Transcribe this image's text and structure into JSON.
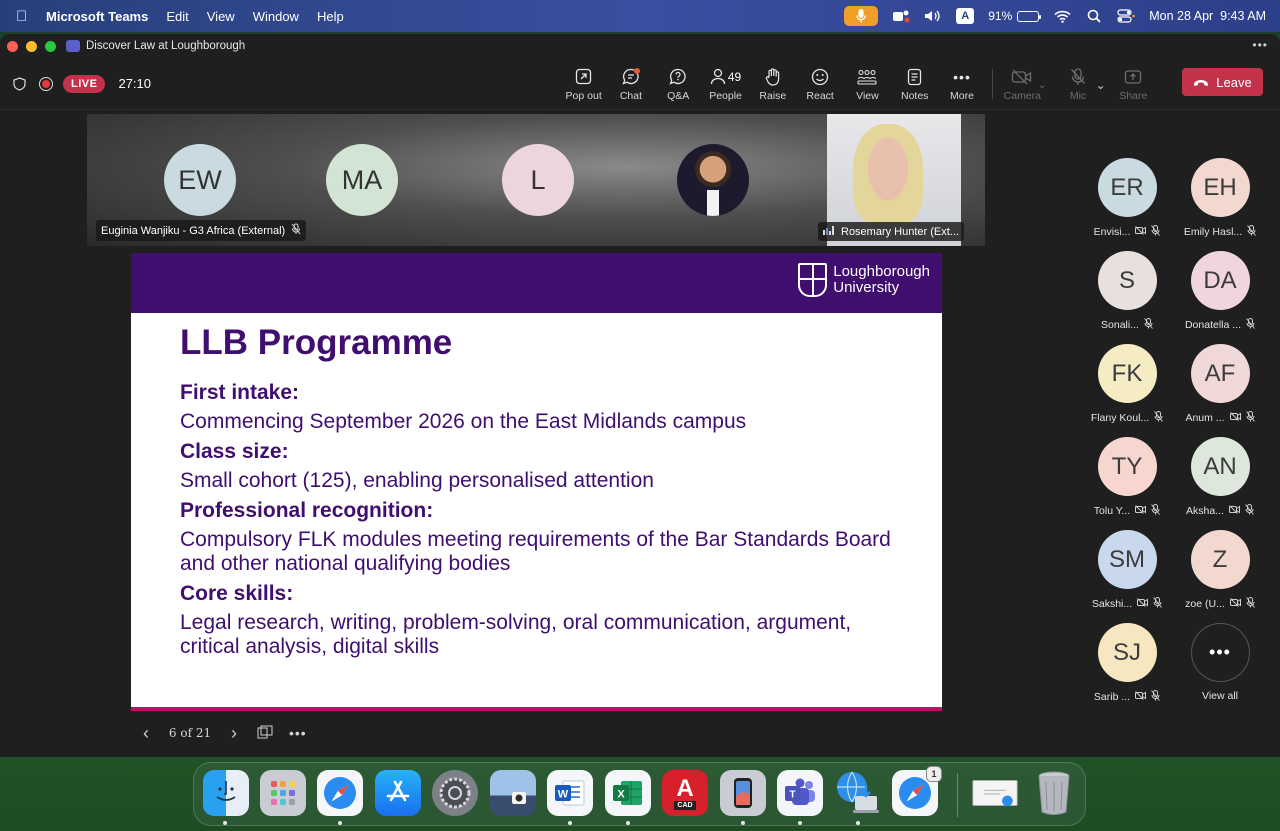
{
  "menubar": {
    "app_name": "Microsoft Teams",
    "menus": [
      "Edit",
      "View",
      "Window",
      "Help"
    ],
    "battery_percent": "91%",
    "battery_level": 0.91,
    "datetime": "Mon 28 Apr  9:43 AM",
    "input_key": "A"
  },
  "window": {
    "title": "Discover Law at Loughborough"
  },
  "toolbar": {
    "live_label": "LIVE",
    "timer": "27:10",
    "actions": {
      "pop_out": "Pop out",
      "chat": "Chat",
      "qa": "Q&A",
      "people": "People",
      "people_count": "49",
      "raise": "Raise",
      "react": "React",
      "view": "View",
      "notes": "Notes",
      "more": "More",
      "camera": "Camera",
      "mic": "Mic",
      "share": "Share"
    },
    "leave_label": "Leave"
  },
  "video_strip": {
    "tiles": [
      {
        "initials": "EW",
        "color": "#c9dbe0"
      },
      {
        "initials": "MA",
        "color": "#d2e4d4"
      },
      {
        "initials": "L",
        "color": "#edd5e0"
      }
    ],
    "name_left": "Euginia Wanjiku - G3 Africa (External)",
    "name_right": "Rosemary Hunter (Ext..."
  },
  "slide": {
    "brand_line1": "Loughborough",
    "brand_line2": "University",
    "title": "LLB Programme",
    "sections": [
      {
        "heading": "First intake:",
        "text": "Commencing September 2026 on the East Midlands campus"
      },
      {
        "heading": "Class size:",
        "text": "Small cohort (125), enabling personalised attention"
      },
      {
        "heading": "Professional recognition:",
        "text": "Compulsory FLK modules meeting requirements of the Bar Standards Board and other national qualifying bodies"
      },
      {
        "heading": "Core skills:",
        "text": "Legal research, writing, problem-solving, oral communication, argument, critical analysis, digital skills"
      }
    ],
    "page_indicator": "6 of 21"
  },
  "participants": [
    {
      "initials": "ER",
      "name": "Envisi...",
      "color": "#c9dbe0"
    },
    {
      "initials": "EH",
      "name": "Emily Hasl...",
      "color": "#f3d8d0"
    },
    {
      "initials": "S",
      "name": "Sonali...",
      "color": "#e8e0dc"
    },
    {
      "initials": "DA",
      "name": "Donatella ...",
      "color": "#f0d4e0"
    },
    {
      "initials": "FK",
      "name": "Flany Koul...",
      "color": "#f6ecc4"
    },
    {
      "initials": "AF",
      "name": "Anum ...",
      "color": "#f0d8d8"
    },
    {
      "initials": "TY",
      "name": "Tolu Y...",
      "color": "#f6d6cf"
    },
    {
      "initials": "AN",
      "name": "Aksha...",
      "color": "#dde7dc"
    },
    {
      "initials": "SM",
      "name": "Sakshi...",
      "color": "#c9d8ec"
    },
    {
      "initials": "Z",
      "name": "zoe (U...",
      "color": "#f3d8d0"
    },
    {
      "initials": "SJ",
      "name": "Sarib ...",
      "color": "#f7e7c0"
    }
  ],
  "view_all_label": "View all",
  "dock": {
    "cad_label": "CAD",
    "badge": "1"
  }
}
